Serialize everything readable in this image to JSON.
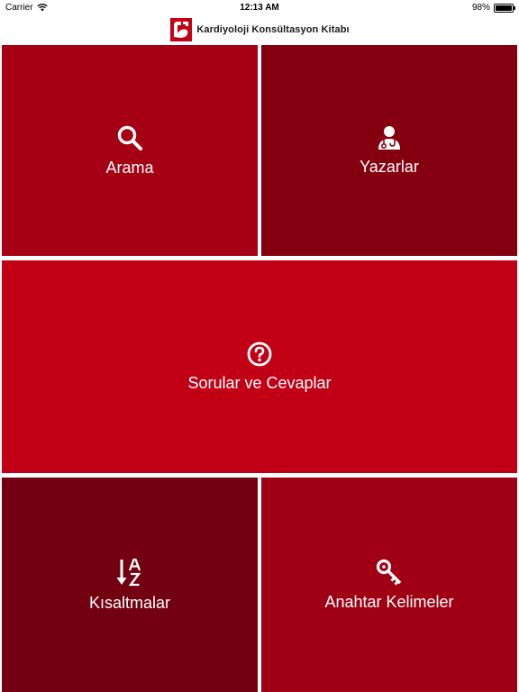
{
  "status_bar": {
    "carrier": "Carrier",
    "time": "12:13 AM",
    "battery": "98%",
    "battery_level": 0.98
  },
  "header": {
    "title": "Kardiyoloji Konsültasyon Kitabı",
    "logo_icon": "heart-logo-icon"
  },
  "tiles": [
    {
      "label": "Arama",
      "icon": "search-icon",
      "color": "#A50013"
    },
    {
      "label": "Yazarlar",
      "icon": "doctor-icon",
      "color": "#840010"
    },
    {
      "label": "Sorular ve Cevaplar",
      "icon": "question-icon",
      "color": "#C10016"
    },
    {
      "label": "Kısaltmalar",
      "icon": "sort-az-icon",
      "color": "#720010"
    },
    {
      "label": "Anahtar Kelimeler",
      "icon": "key-icon",
      "color": "#9F0013"
    }
  ],
  "colors": {
    "background": "#FFFFFF",
    "icon_white": "#FFFFFF"
  }
}
